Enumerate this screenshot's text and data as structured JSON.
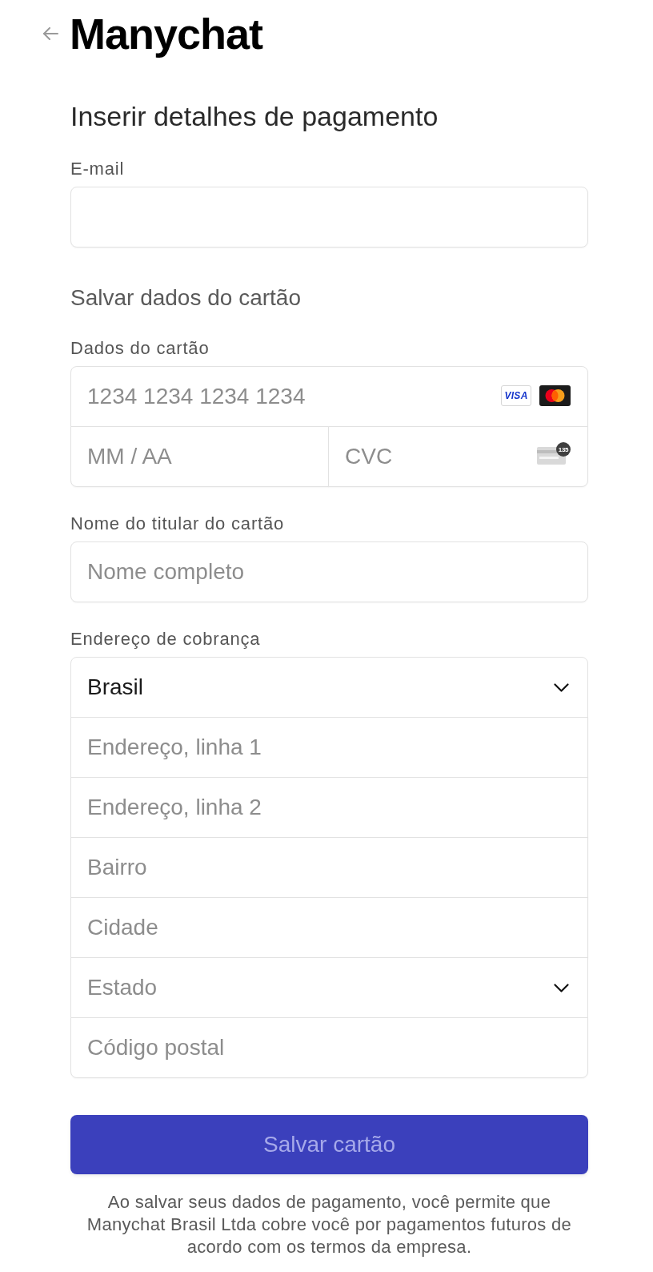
{
  "header": {
    "logo": "Manychat"
  },
  "title": "Inserir detalhes de pagamento",
  "email": {
    "label": "E-mail"
  },
  "section_title": "Salvar dados do cartão",
  "card": {
    "label": "Dados do cartão",
    "number_placeholder": "1234 1234 1234 1234",
    "brands": [
      {
        "kind": "visa",
        "label": "VISA"
      },
      {
        "kind": "mastercard"
      }
    ],
    "expiry_placeholder": "MM / AA",
    "cvc_placeholder": "CVC",
    "cvc_icon_digits": "135"
  },
  "cardholder": {
    "label": "Nome do titular do cartão",
    "placeholder": "Nome completo"
  },
  "billing": {
    "label": "Endereço de cobrança",
    "fields": [
      {
        "kind": "select",
        "value": "Brasil"
      },
      {
        "kind": "text",
        "placeholder": "Endereço, linha 1"
      },
      {
        "kind": "text",
        "placeholder": "Endereço, linha 2"
      },
      {
        "kind": "text",
        "placeholder": "Bairro"
      },
      {
        "kind": "text",
        "placeholder": "Cidade"
      },
      {
        "kind": "select",
        "placeholder": "Estado"
      },
      {
        "kind": "text",
        "placeholder": "Código postal"
      }
    ]
  },
  "submit": {
    "label": "Salvar cartão",
    "disabled": true
  },
  "disclaimer": "Ao salvar seus dados de pagamento, você permite que Manychat Brasil Ltda cobre você por pagamentos futuros de acordo com os termos da empresa."
}
